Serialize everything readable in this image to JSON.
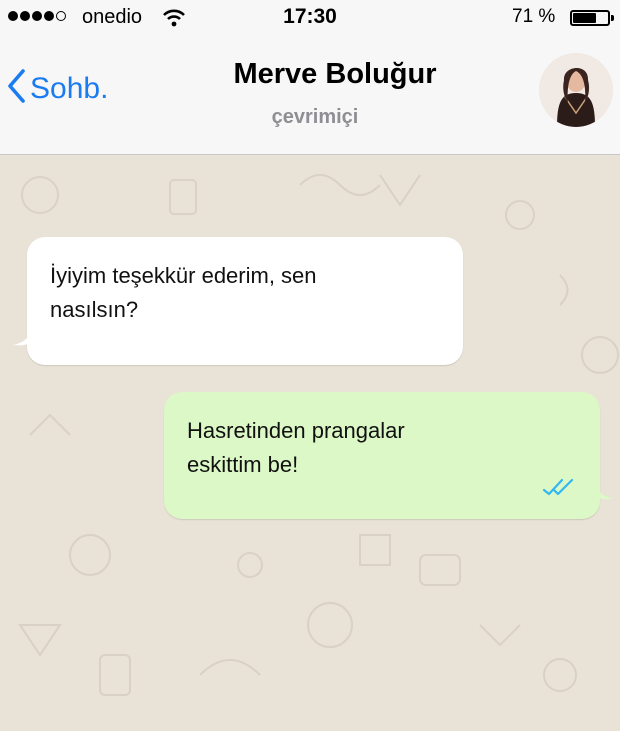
{
  "status_bar": {
    "carrier": "onedio",
    "time": "17:30",
    "battery_percent": "71 %",
    "battery_level": 0.71,
    "signal_bars_filled": 4,
    "signal_bars_total": 5,
    "icons": [
      "wifi-icon",
      "battery-icon"
    ]
  },
  "header": {
    "back_label": "Sohb.",
    "contact_name": "Merve Boluğur",
    "contact_status": "çevrimiçi",
    "icons": [
      "chevron-left-icon",
      "avatar"
    ]
  },
  "messages": [
    {
      "direction": "incoming",
      "text_lines": [
        "İyiyim teşekkür ederim, sen",
        "nasılsın?"
      ]
    },
    {
      "direction": "outgoing",
      "text_lines": [
        "Hasretinden prangalar",
        "eskittim be!"
      ],
      "status_icon": "double-check-icon",
      "status_color": "#34b7f1"
    }
  ],
  "colors": {
    "accent": "#1a7cf0",
    "incoming_bubble": "#ffffff",
    "outgoing_bubble": "#dcf8c6",
    "chat_background": "#e9e2d6"
  }
}
